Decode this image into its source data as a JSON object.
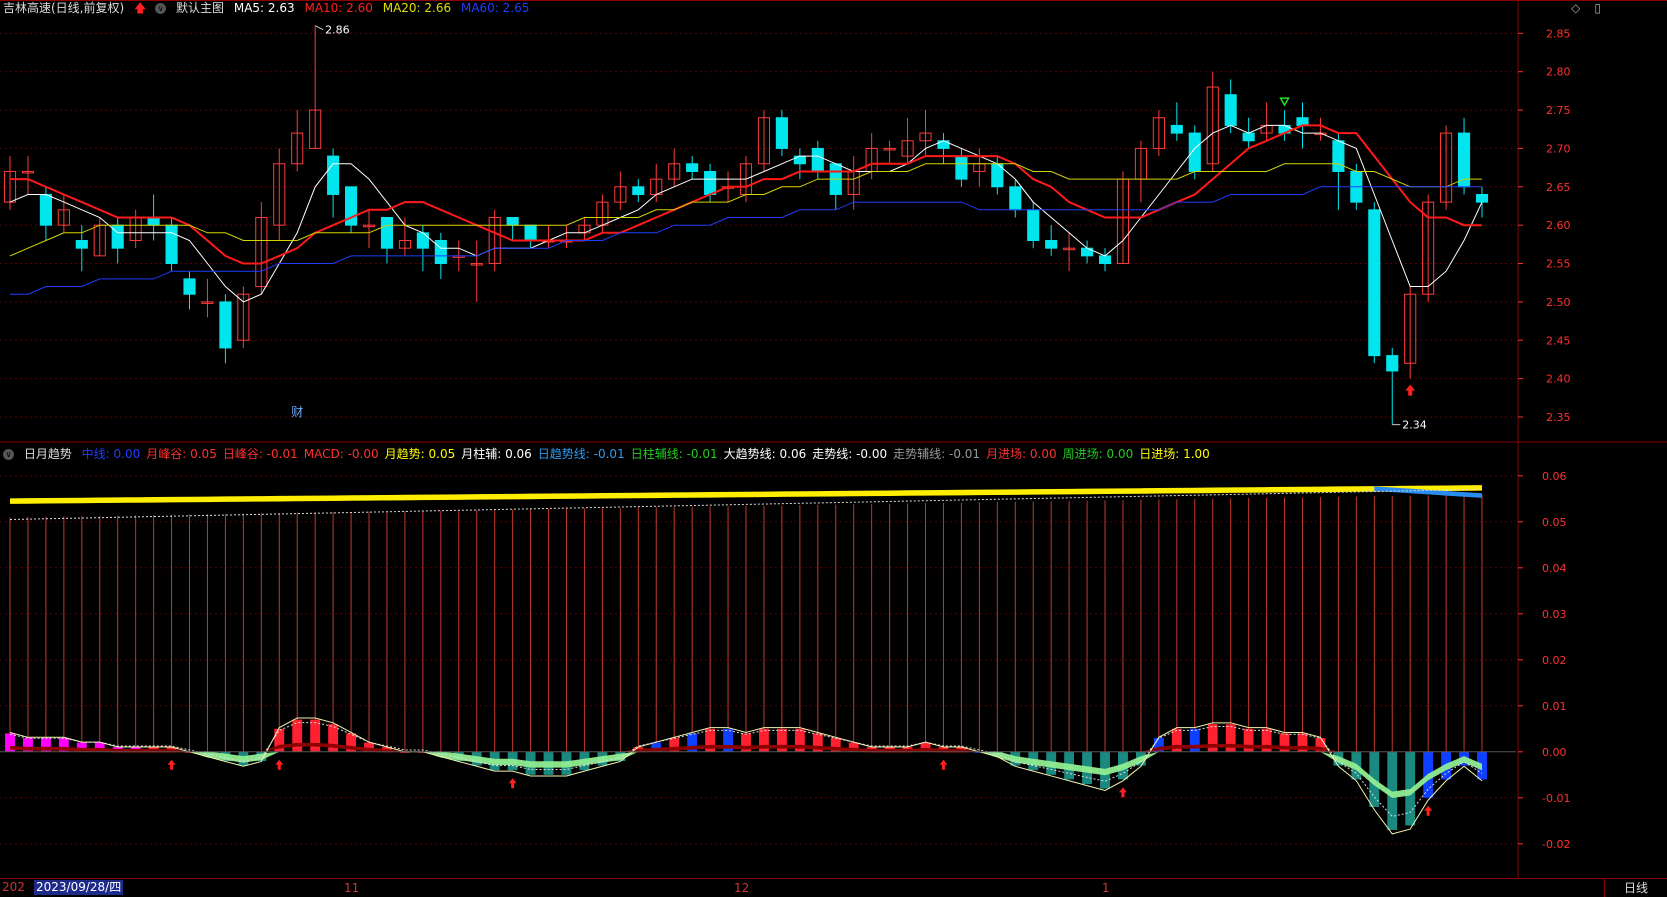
{
  "header": {
    "stock_title": "吉林高速(日线,前复权)",
    "template_label": "默认主图",
    "ma5_label": "MA5: 2.63",
    "ma10_label": "MA10: 2.60",
    "ma20_label": "MA20: 2.66",
    "ma60_label": "MA60: 2.65"
  },
  "indicator_header": {
    "name": "日月趋势",
    "items": [
      {
        "text": "中线: 0.00",
        "color": "#1f3cff"
      },
      {
        "text": "月峰谷: 0.05",
        "color": "#ff3030"
      },
      {
        "text": "日峰谷: -0.01",
        "color": "#ff3030"
      },
      {
        "text": "MACD: -0.00",
        "color": "#ff3030"
      },
      {
        "text": "月趋势: 0.05",
        "color": "#ffff00"
      },
      {
        "text": "月柱辅: 0.06",
        "color": "#ffffff"
      },
      {
        "text": "日趋势线: -0.01",
        "color": "#2a9df4"
      },
      {
        "text": "日柱辅线: -0.01",
        "color": "#22cc22"
      },
      {
        "text": "大趋势线: 0.06",
        "color": "#ffffff"
      },
      {
        "text": "走势线: -0.00",
        "color": "#ffffff"
      },
      {
        "text": "走势辅线: -0.01",
        "color": "#999999"
      },
      {
        "text": "月进场: 0.00",
        "color": "#ff3030"
      },
      {
        "text": "周进场: 0.00",
        "color": "#22cc22"
      },
      {
        "text": "日进场: 1.00",
        "color": "#ffff00"
      }
    ]
  },
  "annotations": {
    "high_label": "2.86",
    "low_label": "2.34",
    "finance_marker": "财"
  },
  "bottom_bar": {
    "year_fragment": "202",
    "date_label": "2023/09/28/四",
    "month_labels": [
      "11",
      "12",
      "1"
    ],
    "period_button": "日线"
  },
  "colors": {
    "up": "#ff3b3b",
    "down": "#00e5ee",
    "ma5": "#ffffff",
    "ma10": "#ff1a1a",
    "ma20": "#d4d400",
    "ma60": "#1f3cff",
    "grid": "#5a0000",
    "axis": "#ff3030"
  },
  "chart_data": [
    {
      "type": "candlestick",
      "title": "吉林高速(日线,前复权)",
      "ylim": [
        2.32,
        2.87
      ],
      "y_ticks": [
        2.35,
        2.4,
        2.45,
        2.5,
        2.55,
        2.6,
        2.65,
        2.7,
        2.75,
        2.8,
        2.85
      ],
      "candles": [
        [
          2.63,
          2.67,
          2.69,
          2.62
        ],
        [
          2.67,
          2.67,
          2.69,
          2.64
        ],
        [
          2.64,
          2.6,
          2.65,
          2.58
        ],
        [
          2.6,
          2.62,
          2.64,
          2.59
        ],
        [
          2.58,
          2.57,
          2.6,
          2.54
        ],
        [
          2.56,
          2.6,
          2.61,
          2.56
        ],
        [
          2.6,
          2.57,
          2.61,
          2.55
        ],
        [
          2.58,
          2.61,
          2.62,
          2.57
        ],
        [
          2.61,
          2.6,
          2.64,
          2.58
        ],
        [
          2.6,
          2.55,
          2.61,
          2.54
        ],
        [
          2.53,
          2.51,
          2.54,
          2.49
        ],
        [
          2.5,
          2.5,
          2.53,
          2.48
        ],
        [
          2.5,
          2.44,
          2.51,
          2.42
        ],
        [
          2.45,
          2.51,
          2.52,
          2.44
        ],
        [
          2.52,
          2.61,
          2.63,
          2.51
        ],
        [
          2.6,
          2.68,
          2.7,
          2.58
        ],
        [
          2.68,
          2.72,
          2.75,
          2.67
        ],
        [
          2.7,
          2.75,
          2.86,
          2.7
        ],
        [
          2.69,
          2.64,
          2.7,
          2.61
        ],
        [
          2.65,
          2.6,
          2.65,
          2.59
        ],
        [
          2.6,
          2.6,
          2.62,
          2.57
        ],
        [
          2.61,
          2.57,
          2.61,
          2.55
        ],
        [
          2.57,
          2.58,
          2.61,
          2.56
        ],
        [
          2.59,
          2.57,
          2.6,
          2.54
        ],
        [
          2.58,
          2.55,
          2.59,
          2.53
        ],
        [
          2.56,
          2.56,
          2.58,
          2.54
        ],
        [
          2.55,
          2.55,
          2.58,
          2.5
        ],
        [
          2.55,
          2.61,
          2.62,
          2.54
        ],
        [
          2.61,
          2.6,
          2.61,
          2.58
        ],
        [
          2.6,
          2.58,
          2.6,
          2.57
        ],
        [
          2.58,
          2.58,
          2.6,
          2.57
        ],
        [
          2.58,
          2.58,
          2.6,
          2.57
        ],
        [
          2.59,
          2.6,
          2.61,
          2.58
        ],
        [
          2.6,
          2.63,
          2.64,
          2.59
        ],
        [
          2.63,
          2.65,
          2.67,
          2.62
        ],
        [
          2.65,
          2.64,
          2.66,
          2.63
        ],
        [
          2.64,
          2.66,
          2.68,
          2.63
        ],
        [
          2.66,
          2.68,
          2.7,
          2.65
        ],
        [
          2.68,
          2.67,
          2.69,
          2.66
        ],
        [
          2.67,
          2.64,
          2.68,
          2.63
        ],
        [
          2.65,
          2.65,
          2.67,
          2.63
        ],
        [
          2.64,
          2.68,
          2.69,
          2.63
        ],
        [
          2.68,
          2.74,
          2.75,
          2.67
        ],
        [
          2.74,
          2.7,
          2.75,
          2.69
        ],
        [
          2.69,
          2.68,
          2.7,
          2.66
        ],
        [
          2.7,
          2.67,
          2.71,
          2.66
        ],
        [
          2.68,
          2.64,
          2.68,
          2.62
        ],
        [
          2.64,
          2.67,
          2.69,
          2.62
        ],
        [
          2.67,
          2.7,
          2.72,
          2.66
        ],
        [
          2.7,
          2.7,
          2.71,
          2.68
        ],
        [
          2.69,
          2.71,
          2.74,
          2.68
        ],
        [
          2.71,
          2.72,
          2.75,
          2.69
        ],
        [
          2.71,
          2.7,
          2.72,
          2.68
        ],
        [
          2.69,
          2.66,
          2.7,
          2.65
        ],
        [
          2.67,
          2.68,
          2.7,
          2.65
        ],
        [
          2.68,
          2.65,
          2.69,
          2.64
        ],
        [
          2.65,
          2.62,
          2.66,
          2.61
        ],
        [
          2.62,
          2.58,
          2.63,
          2.57
        ],
        [
          2.58,
          2.57,
          2.6,
          2.56
        ],
        [
          2.57,
          2.57,
          2.59,
          2.54
        ],
        [
          2.57,
          2.56,
          2.58,
          2.55
        ],
        [
          2.56,
          2.55,
          2.57,
          2.54
        ],
        [
          2.55,
          2.66,
          2.67,
          2.55
        ],
        [
          2.66,
          2.7,
          2.71,
          2.63
        ],
        [
          2.7,
          2.74,
          2.75,
          2.69
        ],
        [
          2.73,
          2.72,
          2.76,
          2.71
        ],
        [
          2.72,
          2.67,
          2.73,
          2.66
        ],
        [
          2.68,
          2.78,
          2.8,
          2.67
        ],
        [
          2.77,
          2.73,
          2.79,
          2.72
        ],
        [
          2.72,
          2.71,
          2.74,
          2.7
        ],
        [
          2.72,
          2.73,
          2.76,
          2.71
        ],
        [
          2.73,
          2.72,
          2.75,
          2.71
        ],
        [
          2.74,
          2.73,
          2.76,
          2.7
        ],
        [
          2.72,
          2.72,
          2.74,
          2.71
        ],
        [
          2.71,
          2.67,
          2.72,
          2.62
        ],
        [
          2.67,
          2.63,
          2.68,
          2.62
        ],
        [
          2.62,
          2.43,
          2.63,
          2.42
        ],
        [
          2.43,
          2.41,
          2.44,
          2.34
        ],
        [
          2.42,
          2.51,
          2.52,
          2.4
        ],
        [
          2.51,
          2.63,
          2.64,
          2.5
        ],
        [
          2.63,
          2.72,
          2.73,
          2.62
        ],
        [
          2.72,
          2.65,
          2.74,
          2.64
        ],
        [
          2.64,
          2.63,
          2.65,
          2.61
        ]
      ],
      "ma_series": [
        {
          "name": "MA5",
          "values": [
            2.63,
            2.64,
            2.64,
            2.63,
            2.62,
            2.61,
            2.59,
            2.59,
            2.59,
            2.59,
            2.58,
            2.55,
            2.52,
            2.5,
            2.51,
            2.55,
            2.59,
            2.65,
            2.68,
            2.68,
            2.66,
            2.63,
            2.6,
            2.59,
            2.57,
            2.57,
            2.56,
            2.57,
            2.57,
            2.57,
            2.58,
            2.59,
            2.59,
            2.6,
            2.61,
            2.62,
            2.64,
            2.65,
            2.66,
            2.66,
            2.66,
            2.66,
            2.67,
            2.68,
            2.69,
            2.69,
            2.68,
            2.67,
            2.67,
            2.67,
            2.68,
            2.7,
            2.71,
            2.7,
            2.69,
            2.68,
            2.66,
            2.63,
            2.61,
            2.59,
            2.57,
            2.56,
            2.58,
            2.61,
            2.64,
            2.67,
            2.7,
            2.72,
            2.73,
            2.72,
            2.73,
            2.73,
            2.72,
            2.72,
            2.71,
            2.7,
            2.64,
            2.58,
            2.52,
            2.52,
            2.54,
            2.58,
            2.63
          ]
        },
        {
          "name": "MA10",
          "values": [
            2.66,
            2.66,
            2.65,
            2.64,
            2.63,
            2.62,
            2.61,
            2.61,
            2.61,
            2.61,
            2.6,
            2.58,
            2.56,
            2.55,
            2.55,
            2.56,
            2.57,
            2.59,
            2.6,
            2.61,
            2.62,
            2.62,
            2.63,
            2.63,
            2.62,
            2.61,
            2.6,
            2.59,
            2.58,
            2.58,
            2.58,
            2.58,
            2.58,
            2.59,
            2.59,
            2.6,
            2.61,
            2.62,
            2.63,
            2.64,
            2.65,
            2.65,
            2.66,
            2.66,
            2.67,
            2.67,
            2.67,
            2.67,
            2.68,
            2.68,
            2.68,
            2.69,
            2.69,
            2.69,
            2.69,
            2.69,
            2.68,
            2.66,
            2.65,
            2.63,
            2.62,
            2.61,
            2.61,
            2.61,
            2.62,
            2.63,
            2.64,
            2.66,
            2.68,
            2.7,
            2.71,
            2.72,
            2.73,
            2.73,
            2.72,
            2.72,
            2.69,
            2.66,
            2.63,
            2.61,
            2.61,
            2.6,
            2.6
          ]
        },
        {
          "name": "MA20",
          "values": [
            2.56,
            2.57,
            2.58,
            2.59,
            2.59,
            2.6,
            2.6,
            2.6,
            2.6,
            2.6,
            2.6,
            2.59,
            2.59,
            2.58,
            2.58,
            2.58,
            2.58,
            2.59,
            2.59,
            2.59,
            2.59,
            2.6,
            2.6,
            2.6,
            2.6,
            2.6,
            2.6,
            2.6,
            2.6,
            2.6,
            2.6,
            2.6,
            2.61,
            2.61,
            2.61,
            2.61,
            2.62,
            2.62,
            2.63,
            2.63,
            2.63,
            2.64,
            2.64,
            2.65,
            2.65,
            2.66,
            2.66,
            2.66,
            2.67,
            2.67,
            2.67,
            2.68,
            2.68,
            2.68,
            2.68,
            2.68,
            2.68,
            2.67,
            2.67,
            2.66,
            2.66,
            2.66,
            2.66,
            2.66,
            2.66,
            2.66,
            2.67,
            2.67,
            2.67,
            2.67,
            2.67,
            2.68,
            2.68,
            2.68,
            2.68,
            2.67,
            2.67,
            2.66,
            2.65,
            2.65,
            2.65,
            2.66,
            2.66
          ]
        },
        {
          "name": "MA60",
          "values": [
            2.51,
            2.51,
            2.52,
            2.52,
            2.52,
            2.53,
            2.53,
            2.53,
            2.53,
            2.54,
            2.54,
            2.54,
            2.54,
            2.54,
            2.54,
            2.55,
            2.55,
            2.55,
            2.55,
            2.56,
            2.56,
            2.56,
            2.56,
            2.56,
            2.56,
            2.56,
            2.56,
            2.57,
            2.57,
            2.57,
            2.57,
            2.58,
            2.58,
            2.58,
            2.59,
            2.59,
            2.59,
            2.6,
            2.6,
            2.6,
            2.61,
            2.61,
            2.61,
            2.61,
            2.62,
            2.62,
            2.62,
            2.63,
            2.63,
            2.63,
            2.63,
            2.63,
            2.63,
            2.63,
            2.62,
            2.62,
            2.62,
            2.62,
            2.62,
            2.62,
            2.62,
            2.62,
            2.62,
            2.62,
            2.62,
            2.63,
            2.63,
            2.63,
            2.64,
            2.64,
            2.64,
            2.64,
            2.64,
            2.65,
            2.65,
            2.65,
            2.65,
            2.65,
            2.65,
            2.65,
            2.65,
            2.65,
            2.65
          ]
        }
      ],
      "signal_arrows": [
        {
          "index": 71,
          "type": "down-green"
        },
        {
          "index": 78,
          "type": "up-red"
        }
      ]
    },
    {
      "type": "bar",
      "title": "日月趋势",
      "ylim": [
        -0.027,
        0.063
      ],
      "y_ticks": [
        -0.02,
        -0.01,
        0.0,
        0.01,
        0.02,
        0.03,
        0.04,
        0.05,
        0.06
      ],
      "histogram": [
        0.004,
        0.003,
        0.003,
        0.003,
        0.002,
        0.002,
        0.001,
        0.001,
        0.001,
        0.001,
        0.0,
        -0.001,
        -0.002,
        -0.003,
        -0.002,
        0.005,
        0.007,
        0.007,
        0.006,
        0.004,
        0.002,
        0.001,
        0.0,
        0.0,
        -0.001,
        -0.002,
        -0.003,
        -0.004,
        -0.004,
        -0.005,
        -0.005,
        -0.005,
        -0.004,
        -0.003,
        -0.002,
        0.001,
        0.002,
        0.003,
        0.004,
        0.005,
        0.005,
        0.004,
        0.005,
        0.005,
        0.005,
        0.004,
        0.003,
        0.002,
        0.001,
        0.001,
        0.001,
        0.002,
        0.001,
        0.001,
        0.0,
        -0.001,
        -0.003,
        -0.004,
        -0.005,
        -0.006,
        -0.007,
        -0.008,
        -0.006,
        -0.003,
        0.003,
        0.005,
        0.005,
        0.006,
        0.006,
        0.005,
        0.005,
        0.004,
        0.004,
        0.003,
        -0.003,
        -0.006,
        -0.012,
        -0.017,
        -0.016,
        -0.01,
        -0.006,
        -0.003,
        -0.006
      ],
      "month_bar_top": 0.055,
      "signal_arrows": [
        9,
        15,
        28,
        52,
        62,
        79
      ]
    }
  ]
}
